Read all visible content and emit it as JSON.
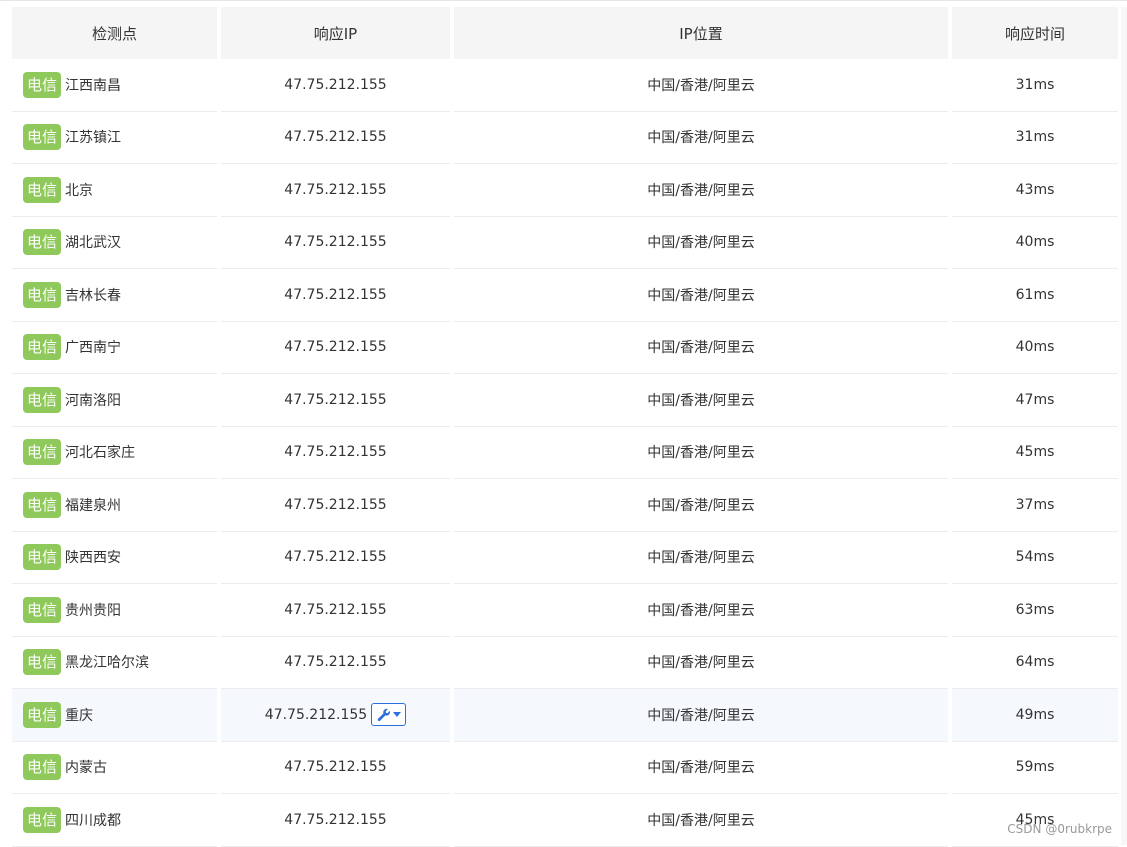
{
  "columns": [
    "检测点",
    "响应IP",
    "IP位置",
    "响应时间"
  ],
  "isp_tag": "电信",
  "rows": [
    {
      "location": "江西南昌",
      "ip": "47.75.212.155",
      "geo": "中国/香港/阿里云",
      "time": "31ms"
    },
    {
      "location": "江苏镇江",
      "ip": "47.75.212.155",
      "geo": "中国/香港/阿里云",
      "time": "31ms"
    },
    {
      "location": "北京",
      "ip": "47.75.212.155",
      "geo": "中国/香港/阿里云",
      "time": "43ms"
    },
    {
      "location": "湖北武汉",
      "ip": "47.75.212.155",
      "geo": "中国/香港/阿里云",
      "time": "40ms"
    },
    {
      "location": "吉林长春",
      "ip": "47.75.212.155",
      "geo": "中国/香港/阿里云",
      "time": "61ms"
    },
    {
      "location": "广西南宁",
      "ip": "47.75.212.155",
      "geo": "中国/香港/阿里云",
      "time": "40ms"
    },
    {
      "location": "河南洛阳",
      "ip": "47.75.212.155",
      "geo": "中国/香港/阿里云",
      "time": "47ms"
    },
    {
      "location": "河北石家庄",
      "ip": "47.75.212.155",
      "geo": "中国/香港/阿里云",
      "time": "45ms"
    },
    {
      "location": "福建泉州",
      "ip": "47.75.212.155",
      "geo": "中国/香港/阿里云",
      "time": "37ms"
    },
    {
      "location": "陕西西安",
      "ip": "47.75.212.155",
      "geo": "中国/香港/阿里云",
      "time": "54ms"
    },
    {
      "location": "贵州贵阳",
      "ip": "47.75.212.155",
      "geo": "中国/香港/阿里云",
      "time": "63ms"
    },
    {
      "location": "黑龙江哈尔滨",
      "ip": "47.75.212.155",
      "geo": "中国/香港/阿里云",
      "time": "64ms"
    },
    {
      "location": "重庆",
      "ip": "47.75.212.155",
      "geo": "中国/香港/阿里云",
      "time": "49ms",
      "hovered": true,
      "tool_icon": "wrench-icon"
    },
    {
      "location": "内蒙古",
      "ip": "47.75.212.155",
      "geo": "中国/香港/阿里云",
      "time": "59ms"
    },
    {
      "location": "四川成都",
      "ip": "47.75.212.155",
      "geo": "中国/香港/阿里云",
      "time": "45ms"
    }
  ],
  "watermark": "CSDN @0rubkrpe",
  "colors": {
    "tag_bg": "#90c95b",
    "header_bg": "#f5f5f5",
    "hover_row_bg": "#f5f8fd",
    "tool_border": "#2a6fdb"
  }
}
